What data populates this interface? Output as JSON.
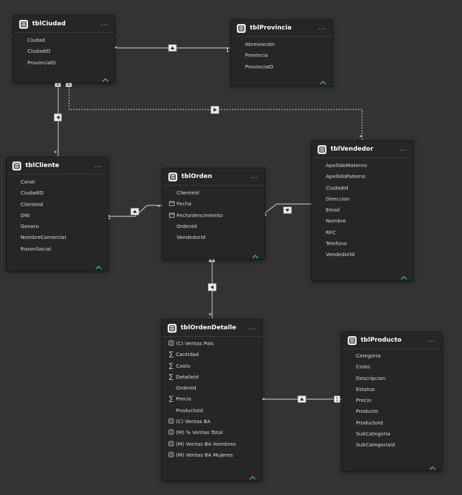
{
  "tables": {
    "tblCiudad": {
      "title": "tblCiudad",
      "more": "...",
      "fields": [
        "Ciudad",
        "CiudadID",
        "ProvinciaID"
      ]
    },
    "tblProvincia": {
      "title": "tblProvincia",
      "more": "...",
      "fields": [
        "Abreviación",
        "Provincia",
        "ProvinciaID"
      ]
    },
    "tblCliente": {
      "title": "tblCliente",
      "more": "...",
      "fields": [
        "Canal",
        "CiudadID",
        "ClienteId",
        "DNI",
        "Genero",
        "NombreComercial",
        "RazonSocial"
      ]
    },
    "tblOrden": {
      "title": "tblOrden",
      "more": "...",
      "fields": [
        "ClienteId",
        "Fecha",
        "FechaVencimiento",
        "OrdenId",
        "VendedorId"
      ]
    },
    "tblVendedor": {
      "title": "tblVendedor",
      "more": "...",
      "fields": [
        "ApellidoMaterno",
        "ApellidoPaterno",
        "CiudadId",
        "Direccion",
        "Email",
        "Nombre",
        "RFC",
        "Telefono",
        "VendedorId"
      ]
    },
    "tblOrdenDetalle": {
      "title": "tblOrdenDetalle",
      "more": "...",
      "fields": [
        "(C) Ventas País",
        "Cantidad",
        "Costo",
        "DetalleId",
        "OrdenId",
        "Precio",
        "ProductoId",
        "(C) Ventas BA",
        "(M) % Ventas Total",
        "(M) Ventas BA Hombres",
        "(M) Ventas BA Mujeres"
      ]
    },
    "tblProducto": {
      "title": "tblProducto",
      "more": "...",
      "fields": [
        "Categoria",
        "Costo",
        "Descripcion",
        "Estatus",
        "Precio",
        "Producto",
        "ProductoId",
        "SubCategoria",
        "SubCategoriaId"
      ]
    }
  },
  "cardinality": {
    "one": "1",
    "many": "*"
  },
  "colors": {
    "background": "#333333",
    "card": "#262626",
    "accent": "#3fbf8f",
    "line": "#bdbdbd"
  },
  "icons": {
    "table": "table-icon",
    "sum": "sigma-icon",
    "calendar": "calendar-icon",
    "calculated": "calculator-icon",
    "collapse": "chevron-up-icon",
    "more": "more-icon"
  }
}
